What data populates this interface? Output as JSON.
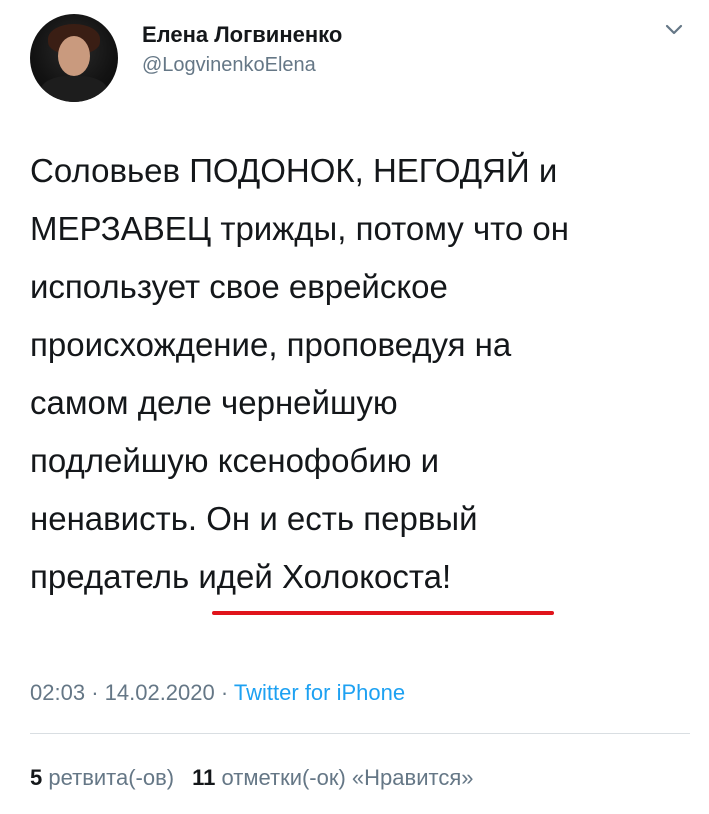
{
  "tweet": {
    "author": {
      "name": "Елена Логвиненко",
      "handle": "@LogvinenkoElena"
    },
    "text_lines": [
      "Соловьев ПОДОНОК, НЕГОДЯЙ и",
      "МЕРЗАВЕЦ трижды, потому что он",
      "использует свое еврейское",
      "происхождение, проповедуя на",
      "самом деле чернейшую",
      "подлейшую ксенофобию и",
      "ненависть. Он и есть первый",
      "предатель идей Холокоста!"
    ],
    "meta": {
      "time": "02:03",
      "separator": "·",
      "date": "14.02.2020",
      "source": "Twitter for iPhone"
    },
    "stats": {
      "retweets_count": "5",
      "retweets_label": "ретвита(-ов)",
      "likes_count": "11",
      "likes_label": "отметки(-ок) «Нравится»"
    }
  },
  "colors": {
    "text": "#14171a",
    "secondary": "#657786",
    "link": "#1da1f2",
    "highlight_underline": "#e0141b",
    "divider": "#d9dee2"
  },
  "icons": {
    "menu": "chevron-down-icon"
  }
}
